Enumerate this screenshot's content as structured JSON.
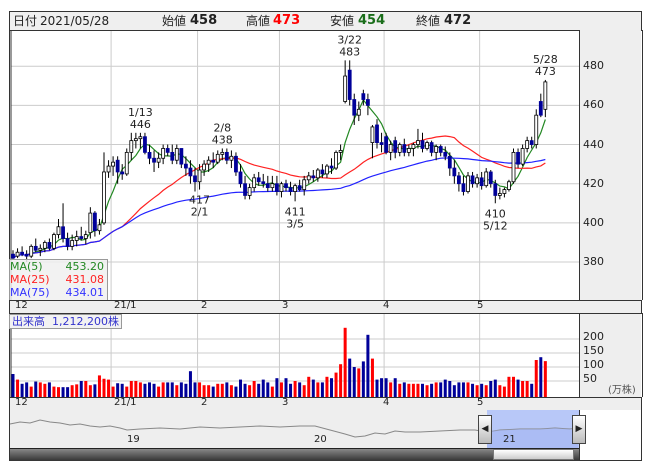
{
  "header": {
    "date_label": "日付",
    "date": "2021/05/28",
    "open_label": "始値",
    "open": "458",
    "high_label": "高値",
    "high": "473",
    "low_label": "安値",
    "low": "454",
    "close_label": "終値",
    "close": "472"
  },
  "legend": {
    "ma5_label": "MA(5)",
    "ma5": "453.20",
    "ma25_label": "MA(25)",
    "ma25": "431.08",
    "ma75_label": "MA(75)",
    "ma75": "434.01"
  },
  "volume_label": "出来高",
  "volume_value": "1,212,200株",
  "volume_unit": "(万株)",
  "x_ticks": [
    "12",
    "21/1",
    "2",
    "3",
    "4",
    "5"
  ],
  "navigator": {
    "years": [
      "19",
      "20",
      "21"
    ]
  },
  "colors": {
    "up": "#ffffff",
    "down": "#000099",
    "vol_up": "#ff0000",
    "vol_down": "#000099",
    "ma5": "#228822",
    "ma25": "#ff2222",
    "ma75": "#2222ff",
    "nav_range": "#b8c8f8"
  },
  "chart_data": {
    "type": "candlestick",
    "title": "",
    "price_ticks": [
      "480",
      "460",
      "440",
      "420",
      "400",
      "380"
    ],
    "ylim": [
      360.6,
      498
    ],
    "volume_ticks": [
      "200",
      "150",
      "100",
      "50"
    ],
    "volume_ylim": [
      0,
      250
    ],
    "month_start_index": {
      "12": 0,
      "21/1": 22,
      "2": 41,
      "3": 59,
      "4": 82,
      "5": 103
    },
    "annotations": [
      {
        "i": 28,
        "date": "1/13",
        "value": "446",
        "pos": "above"
      },
      {
        "i": 46,
        "date": "2/8",
        "value": "438",
        "pos": "above"
      },
      {
        "i": 74,
        "date": "3/22",
        "value": "483",
        "pos": "above"
      },
      {
        "i": 117,
        "date": "5/28",
        "value": "473",
        "pos": "above"
      },
      {
        "i": 41,
        "date": "2/1",
        "value": "417",
        "pos": "below"
      },
      {
        "i": 62,
        "date": "3/5",
        "value": "411",
        "pos": "below"
      },
      {
        "i": 106,
        "date": "5/12",
        "value": "410",
        "pos": "below"
      }
    ],
    "ohlc": [
      [
        384,
        386,
        381,
        382
      ],
      [
        383,
        387,
        382,
        385
      ],
      [
        385,
        388,
        383,
        384
      ],
      [
        384,
        386,
        380,
        383
      ],
      [
        383,
        389,
        382,
        388
      ],
      [
        388,
        392,
        385,
        386
      ],
      [
        386,
        389,
        383,
        387
      ],
      [
        387,
        391,
        385,
        390
      ],
      [
        390,
        392,
        386,
        387
      ],
      [
        387,
        395,
        386,
        394
      ],
      [
        394,
        402,
        392,
        398
      ],
      [
        398,
        410,
        390,
        392
      ],
      [
        392,
        395,
        386,
        388
      ],
      [
        388,
        394,
        386,
        391
      ],
      [
        391,
        396,
        388,
        393
      ],
      [
        393,
        398,
        391,
        392
      ],
      [
        392,
        396,
        389,
        394
      ],
      [
        395,
        408,
        392,
        405
      ],
      [
        405,
        406,
        393,
        396
      ],
      [
        396,
        402,
        394,
        399
      ],
      [
        400,
        436,
        399,
        426
      ],
      [
        426,
        432,
        423,
        429
      ],
      [
        429,
        434,
        424,
        431
      ],
      [
        432,
        434,
        420,
        426
      ],
      [
        426,
        430,
        422,
        425
      ],
      [
        425,
        438,
        424,
        436
      ],
      [
        436,
        446,
        432,
        442
      ],
      [
        442,
        446,
        438,
        443
      ],
      [
        443,
        446,
        438,
        444
      ],
      [
        444,
        446,
        435,
        436
      ],
      [
        436,
        440,
        430,
        433
      ],
      [
        433,
        437,
        426,
        431
      ],
      [
        431,
        436,
        428,
        433
      ],
      [
        433,
        440,
        430,
        438
      ],
      [
        438,
        440,
        434,
        436
      ],
      [
        436,
        440,
        430,
        432
      ],
      [
        432,
        440,
        430,
        438
      ],
      [
        438,
        438,
        428,
        430
      ],
      [
        430,
        434,
        424,
        428
      ],
      [
        428,
        432,
        420,
        424
      ],
      [
        424,
        428,
        416,
        421
      ],
      [
        421,
        430,
        417,
        427
      ],
      [
        427,
        432,
        424,
        430
      ],
      [
        430,
        434,
        426,
        432
      ],
      [
        432,
        436,
        428,
        431
      ],
      [
        431,
        437,
        430,
        435
      ],
      [
        435,
        438,
        432,
        436
      ],
      [
        436,
        438,
        430,
        432
      ],
      [
        432,
        437,
        428,
        434
      ],
      [
        434,
        436,
        424,
        426
      ],
      [
        426,
        430,
        418,
        420
      ],
      [
        420,
        424,
        412,
        414
      ],
      [
        414,
        420,
        412,
        418
      ],
      [
        418,
        425,
        416,
        423
      ],
      [
        423,
        426,
        419,
        421
      ],
      [
        421,
        425,
        418,
        420
      ],
      [
        420,
        424,
        416,
        418
      ],
      [
        418,
        424,
        416,
        420
      ],
      [
        420,
        424,
        414,
        416
      ],
      [
        416,
        421,
        413,
        420
      ],
      [
        420,
        422,
        416,
        418
      ],
      [
        418,
        421,
        414,
        416
      ],
      [
        416,
        420,
        411,
        419
      ],
      [
        419,
        422,
        416,
        417
      ],
      [
        417,
        424,
        414,
        422
      ],
      [
        422,
        426,
        420,
        424
      ],
      [
        424,
        427,
        421,
        423
      ],
      [
        423,
        428,
        421,
        427
      ],
      [
        427,
        430,
        423,
        425
      ],
      [
        425,
        430,
        423,
        429
      ],
      [
        429,
        433,
        425,
        428
      ],
      [
        428,
        437,
        427,
        436
      ],
      [
        436,
        440,
        432,
        437
      ],
      [
        462,
        483,
        461,
        475
      ],
      [
        478,
        483,
        460,
        463
      ],
      [
        463,
        466,
        450,
        455
      ],
      [
        455,
        462,
        452,
        458
      ],
      [
        466,
        468,
        460,
        463
      ],
      [
        463,
        466,
        455,
        460
      ],
      [
        441,
        450,
        433,
        449
      ],
      [
        450,
        453,
        438,
        441
      ],
      [
        441,
        446,
        436,
        440
      ],
      [
        444,
        446,
        435,
        436
      ],
      [
        436,
        442,
        432,
        440
      ],
      [
        442,
        444,
        433,
        436
      ],
      [
        436,
        441,
        434,
        440
      ],
      [
        440,
        443,
        434,
        436
      ],
      [
        436,
        440,
        434,
        438
      ],
      [
        438,
        441,
        434,
        440
      ],
      [
        440,
        448,
        438,
        442
      ],
      [
        442,
        446,
        436,
        438
      ],
      [
        438,
        442,
        437,
        441
      ],
      [
        441,
        442,
        434,
        436
      ],
      [
        436,
        440,
        432,
        439
      ],
      [
        439,
        440,
        434,
        436
      ],
      [
        436,
        439,
        432,
        434
      ],
      [
        434,
        436,
        424,
        428
      ],
      [
        428,
        432,
        420,
        424
      ],
      [
        424,
        426,
        416,
        420
      ],
      [
        420,
        424,
        414,
        416
      ],
      [
        416,
        426,
        415,
        424
      ],
      [
        424,
        426,
        418,
        420
      ],
      [
        420,
        425,
        418,
        423
      ],
      [
        423,
        426,
        417,
        419
      ],
      [
        419,
        428,
        418,
        426
      ],
      [
        426,
        427,
        418,
        420
      ],
      [
        420,
        422,
        410,
        414
      ],
      [
        414,
        418,
        412,
        415
      ],
      [
        415,
        418,
        413,
        417
      ],
      [
        417,
        422,
        416,
        421
      ],
      [
        421,
        438,
        420,
        436
      ],
      [
        436,
        438,
        428,
        430
      ],
      [
        430,
        440,
        429,
        438
      ],
      [
        438,
        444,
        436,
        442
      ],
      [
        442,
        444,
        438,
        440
      ],
      [
        440,
        458,
        438,
        455
      ],
      [
        462,
        466,
        454,
        455
      ],
      [
        458,
        473,
        454,
        472
      ]
    ],
    "volume": [
      75,
      55,
      40,
      45,
      30,
      48,
      45,
      40,
      45,
      30,
      28,
      28,
      28,
      35,
      38,
      50,
      50,
      35,
      38,
      70,
      58,
      55,
      30,
      42,
      40,
      30,
      50,
      50,
      45,
      40,
      45,
      40,
      30,
      45,
      45,
      45,
      35,
      45,
      40,
      85,
      45,
      45,
      35,
      35,
      30,
      40,
      40,
      45,
      35,
      30,
      55,
      40,
      35,
      50,
      40,
      55,
      45,
      30,
      60,
      45,
      60,
      40,
      50,
      45,
      35,
      65,
      55,
      45,
      45,
      65,
      60,
      80,
      110,
      240,
      130,
      100,
      95,
      120,
      215,
      130,
      55,
      60,
      60,
      45,
      60,
      40,
      45,
      40,
      40,
      40,
      40,
      35,
      40,
      45,
      45,
      55,
      50,
      35,
      45,
      45,
      45,
      40,
      35,
      40,
      35,
      50,
      55,
      35,
      30,
      65,
      65,
      55,
      50,
      50,
      40,
      125,
      135,
      121
    ],
    "ma_periods": [
      5,
      25,
      75
    ]
  }
}
